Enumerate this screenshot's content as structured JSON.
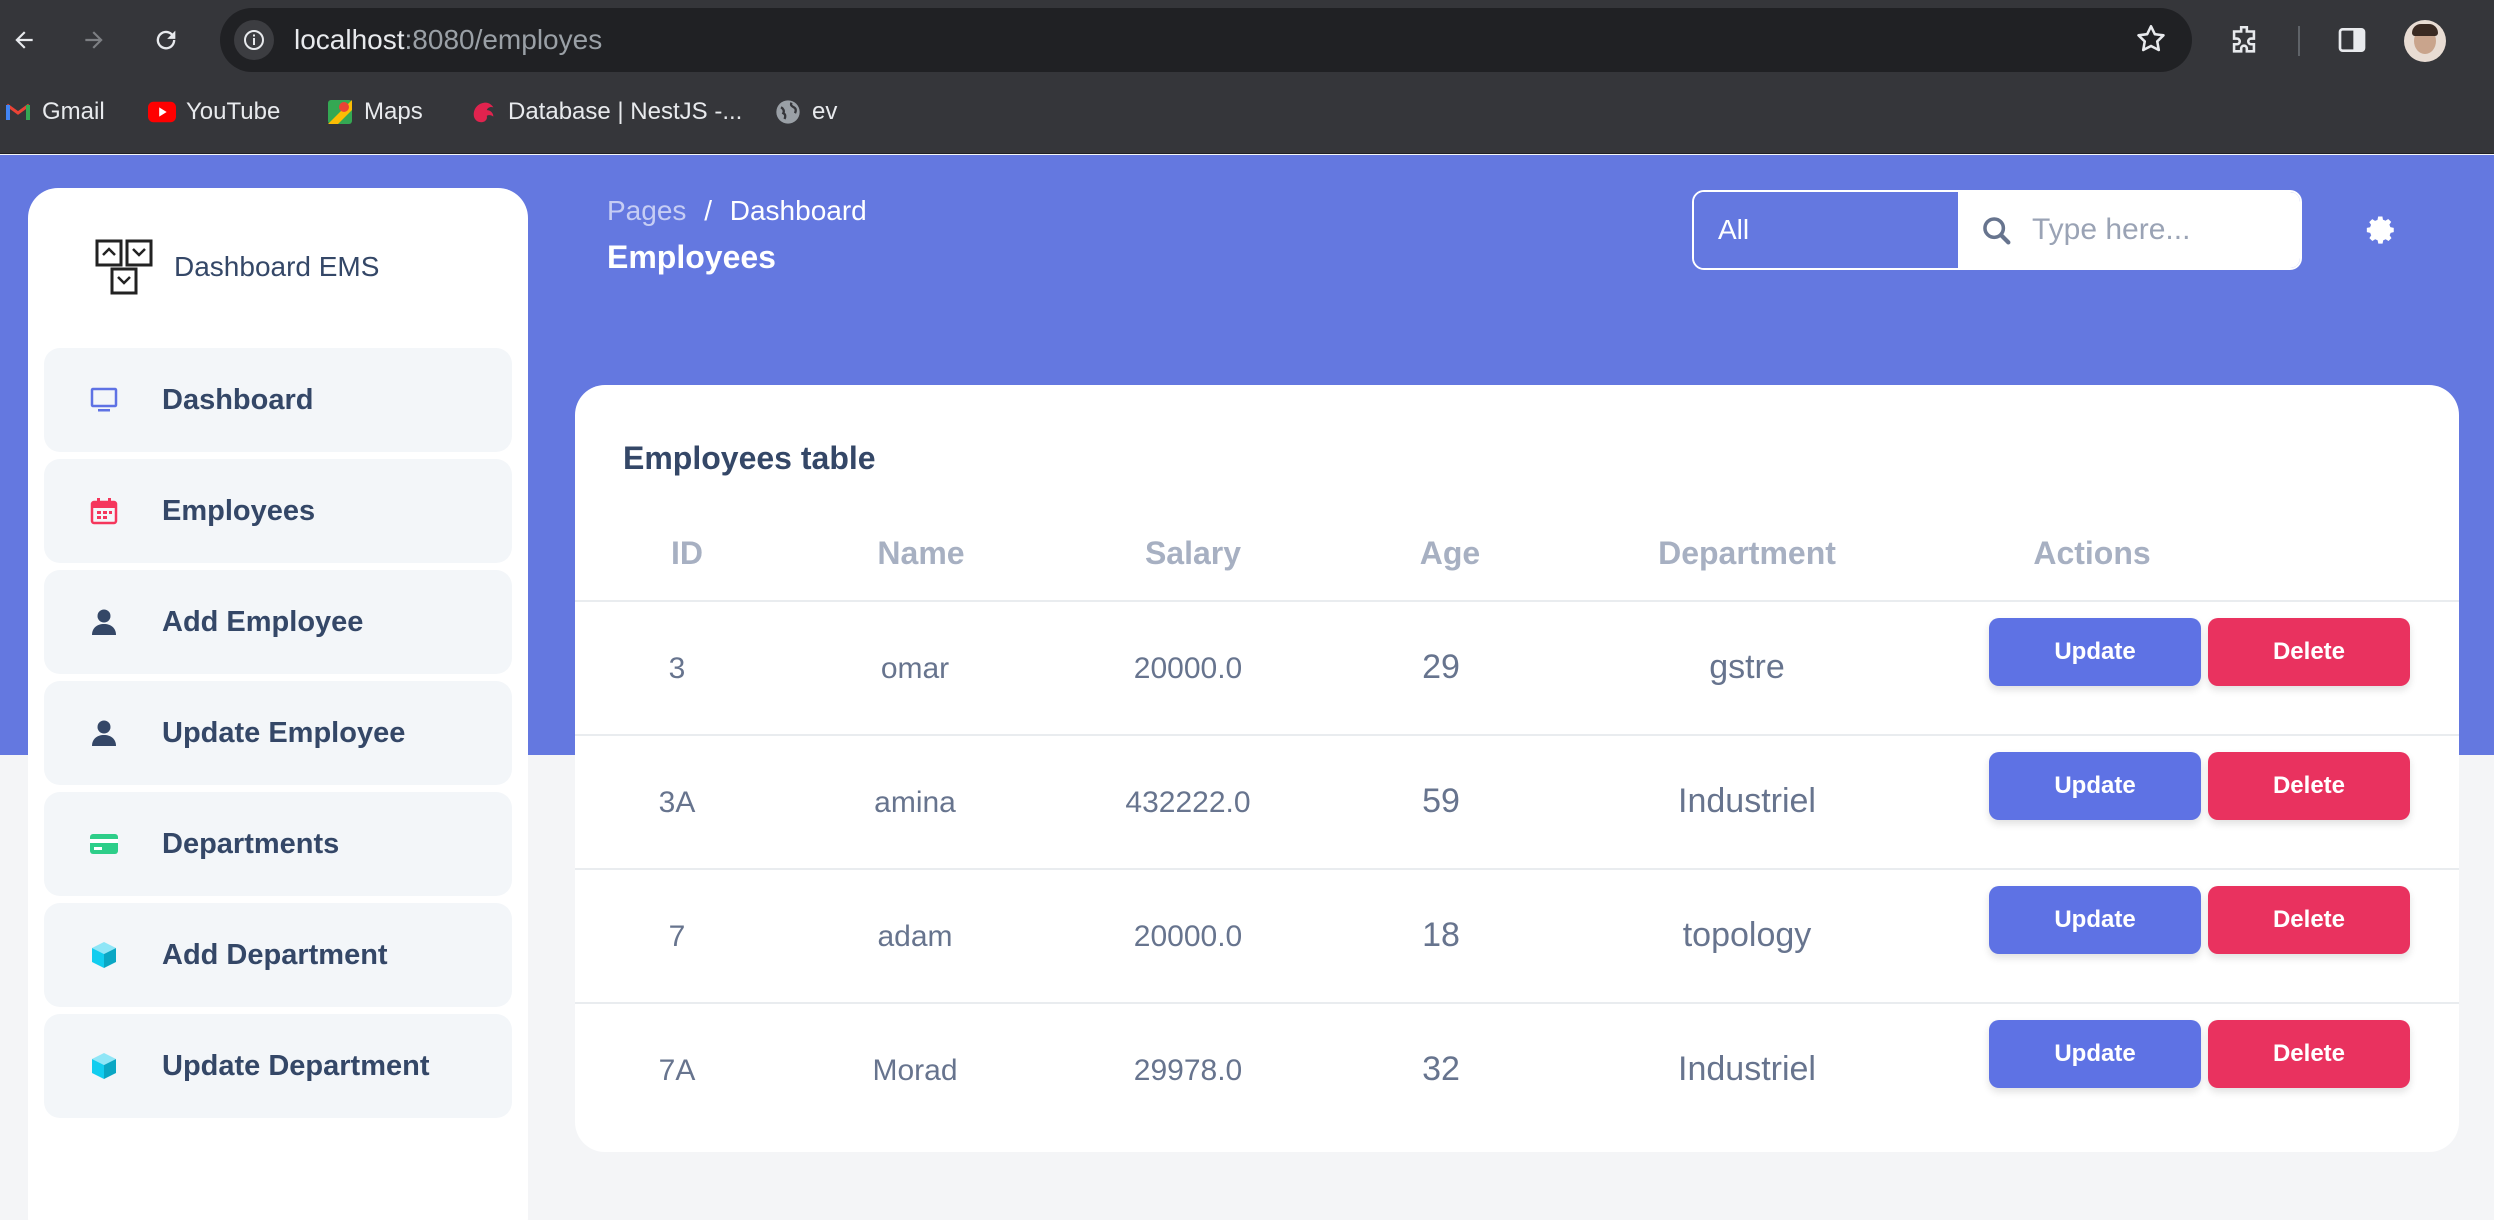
{
  "browser": {
    "url_host": "localhost",
    "url_rest": ":8080/employes",
    "bookmarks": [
      {
        "label": "Gmail",
        "icon": "gmail-icon"
      },
      {
        "label": "YouTube",
        "icon": "youtube-icon"
      },
      {
        "label": "Maps",
        "icon": "maps-icon"
      },
      {
        "label": "Database | NestJS -...",
        "icon": "nestjs-icon"
      },
      {
        "label": "ev",
        "icon": "globe-icon"
      }
    ]
  },
  "sidebar": {
    "brand": "Dashboard EMS",
    "items": [
      {
        "label": "Dashboard",
        "icon": "monitor-icon",
        "color": "#5e72e4"
      },
      {
        "label": "Employees",
        "icon": "calendar-icon",
        "color": "#f5365c"
      },
      {
        "label": "Add Employee",
        "icon": "user-icon",
        "color": "#344767"
      },
      {
        "label": "Update Employee",
        "icon": "user-icon",
        "color": "#344767"
      },
      {
        "label": "Departments",
        "icon": "credit-card-icon",
        "color": "#2dce89"
      },
      {
        "label": "Add Department",
        "icon": "box-icon",
        "color": "#11cdef"
      },
      {
        "label": "Update Department",
        "icon": "box-icon",
        "color": "#11cdef"
      }
    ]
  },
  "header": {
    "breadcrumb_root": "Pages",
    "breadcrumb_sep": "/",
    "breadcrumb_current": "Dashboard",
    "title": "Employees",
    "filter_value": "All",
    "search_placeholder": "Type here..."
  },
  "table": {
    "title": "Employees table",
    "columns": [
      "ID",
      "Name",
      "Salary",
      "Age",
      "Department",
      "Actions"
    ],
    "rows": [
      {
        "id": "3",
        "name": "omar",
        "salary": "20000.0",
        "age": "29",
        "department": "gstre"
      },
      {
        "id": "3A",
        "name": "amina",
        "salary": "432222.0",
        "age": "59",
        "department": "Industriel"
      },
      {
        "id": "7",
        "name": "adam",
        "salary": "20000.0",
        "age": "18",
        "department": "topology"
      },
      {
        "id": "7A",
        "name": "Morad",
        "salary": "29978.0",
        "age": "32",
        "department": "Industriel"
      }
    ],
    "update_label": "Update",
    "delete_label": "Delete"
  },
  "colors": {
    "accent": "#6478e0",
    "update": "#5e72e4",
    "delete": "#e9325f"
  }
}
